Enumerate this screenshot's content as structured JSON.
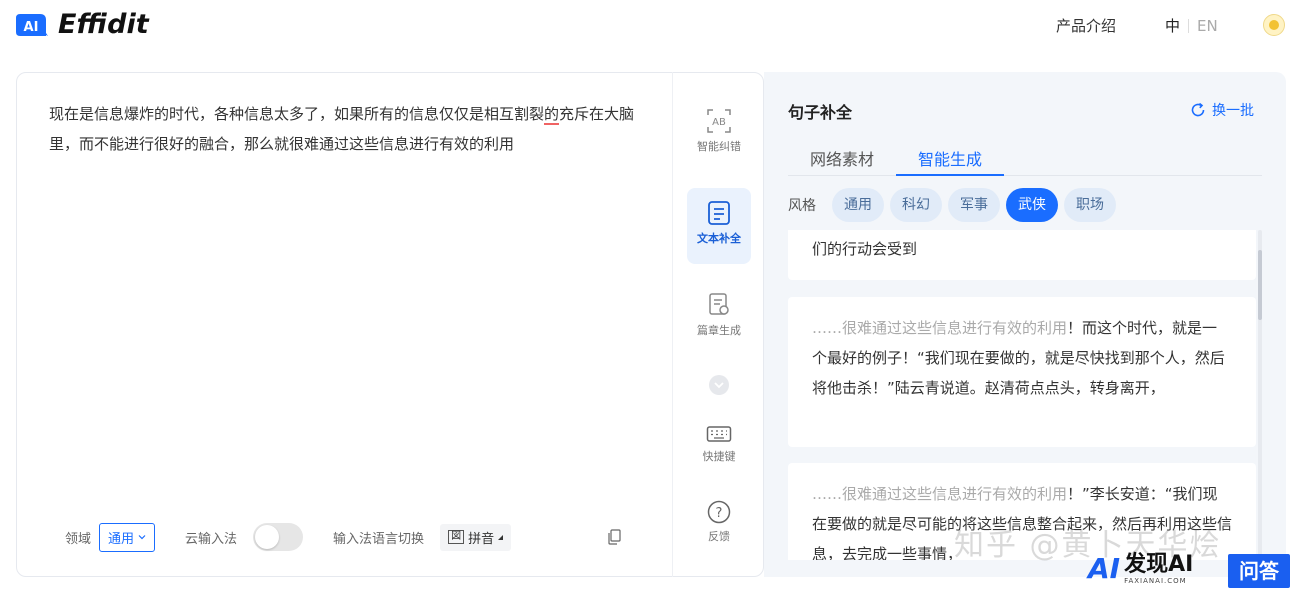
{
  "header": {
    "logo_badge": "AI",
    "logo_text_pre": "Eff",
    "logo_text_accent": "i",
    "logo_text_post": "dit",
    "nav_product": "产品介绍",
    "lang_zh": "中",
    "lang_en": "EN"
  },
  "editor": {
    "text_part1": "现在是信息爆炸的时代，各种信息太多了，如果所有的信息仅仅是相互割裂",
    "text_underlined": "的",
    "text_part2": "充斥在大脑里，而不能进行很好的融合，那么就很难通过这些信息进行有效的利用",
    "footer": {
      "domain_label": "领域",
      "domain_value": "通用",
      "cloud_ime_label": "云输入法",
      "ime_switch_label": "输入法语言切换",
      "pinyin_box": "図",
      "pinyin_label": "拼音"
    }
  },
  "tools": {
    "correct": "智能纠错",
    "complete": "文本补全",
    "article": "篇章生成",
    "shortcut": "快捷键",
    "feedback": "反馈"
  },
  "panel": {
    "title": "句子补全",
    "refresh": "换一批",
    "tabs": [
      "网络素材",
      "智能生成"
    ],
    "style_label": "风格",
    "styles": [
      "通用",
      "科幻",
      "军事",
      "武侠",
      "职场"
    ],
    "active_style": "武侠",
    "results": [
      {
        "lead": "",
        "text": "们的行动会受到"
      },
      {
        "lead": "……很难通过这些信息进行有效的利用",
        "text": "！而这个时代，就是一个最好的例子！“我们现在要做的，就是尽快找到那个人，然后将他击杀！”陆云青说道。赵清荷点点头，转身离开，"
      },
      {
        "lead": "……很难通过这些信息进行有效的利用",
        "text": "！”李长安道：“我们现在要做的就是尽可能的将这些信息整合起来，然后再利用这些信息，去完成一些事情，"
      }
    ]
  },
  "watermark": {
    "text": "知乎 @黄卜天华烩",
    "brand_icon": "AI",
    "brand": "发现AI",
    "brand_sub": "FAXIANAI.COM",
    "qa": "问答"
  },
  "colors": {
    "accent": "#1a6dff",
    "panel_bg": "#f3f6fa",
    "chip_bg": "#e1ebf8",
    "error_underline": "#f06363"
  }
}
